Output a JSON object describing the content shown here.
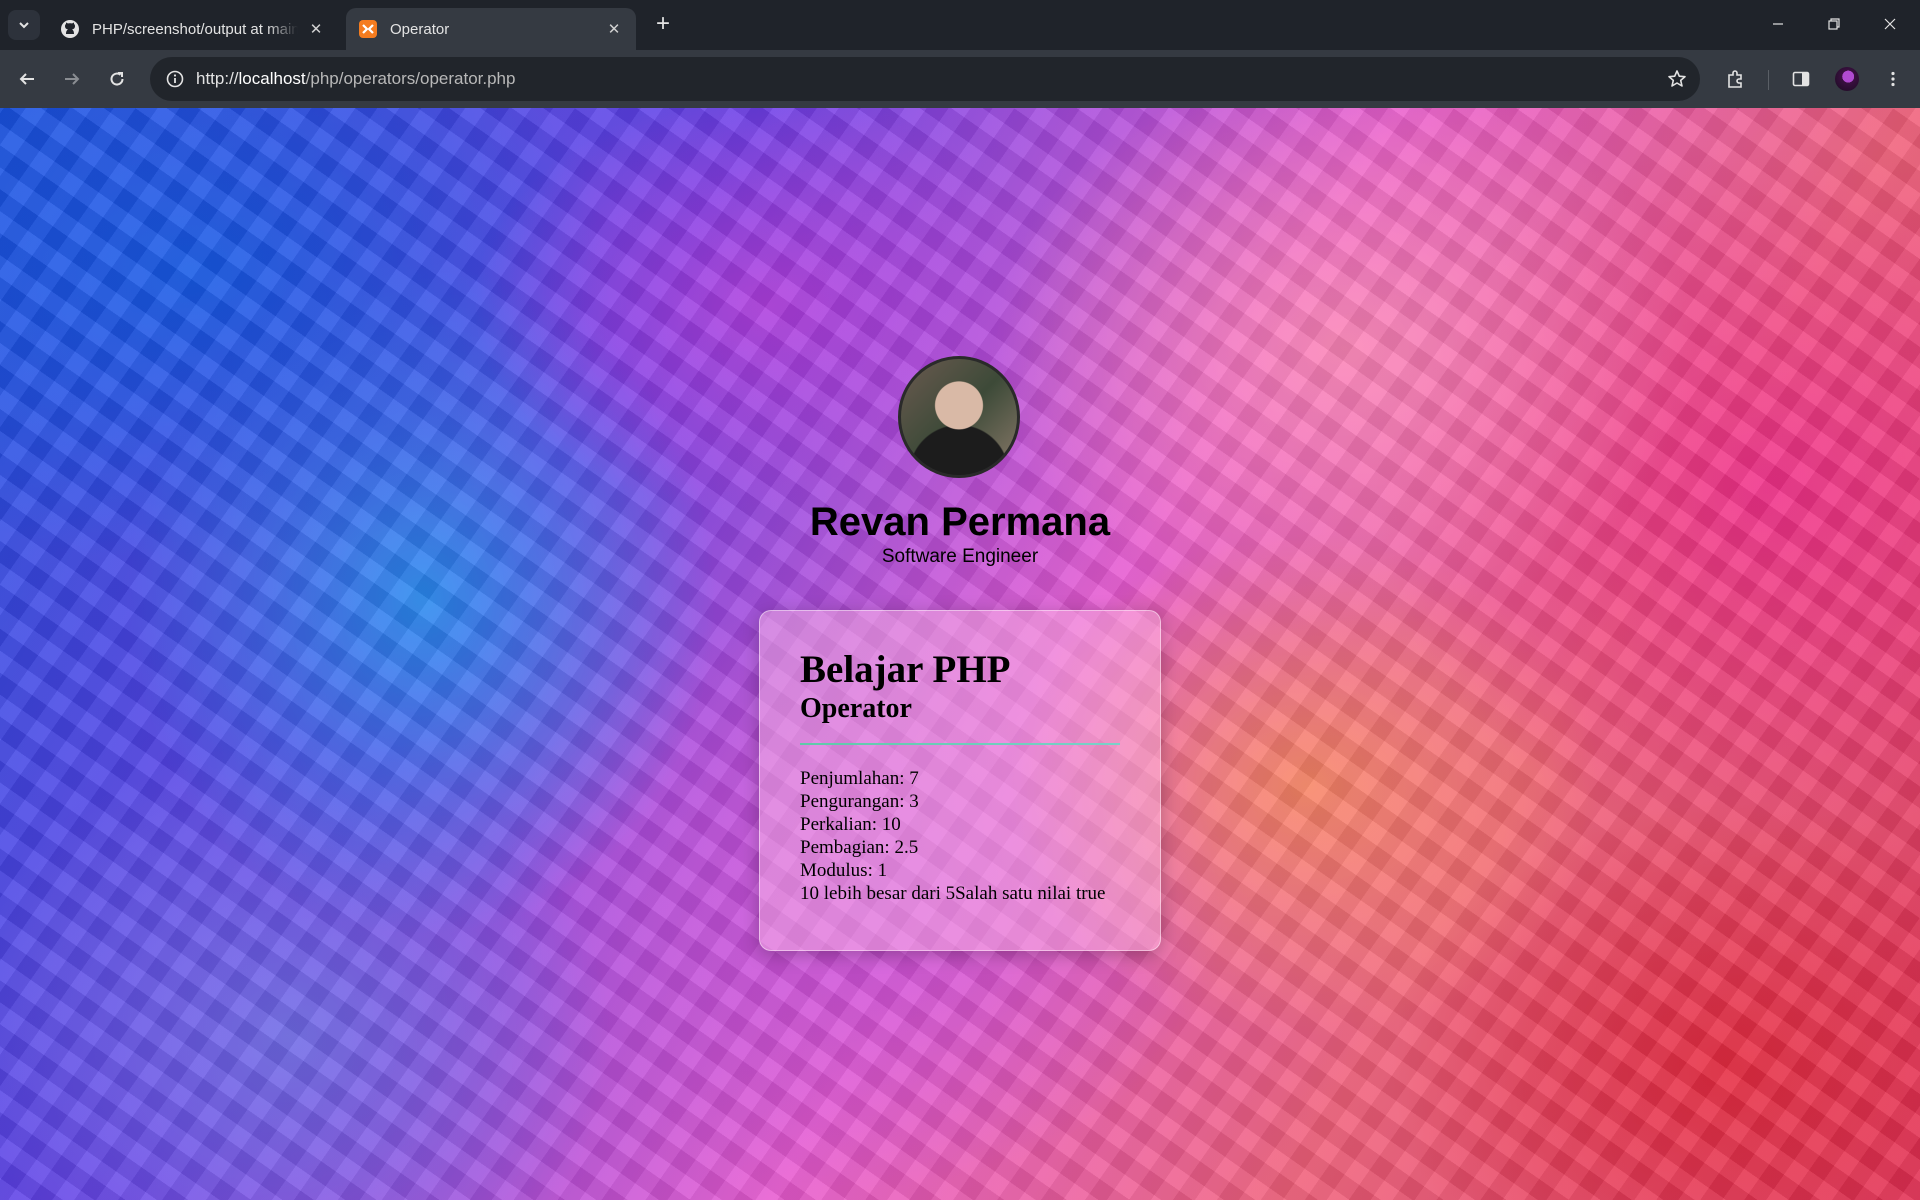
{
  "browser": {
    "tabs": [
      {
        "title": "PHP/screenshot/output at main",
        "active": false,
        "icon": "github-icon"
      },
      {
        "title": "Operator",
        "active": true,
        "icon": "xampp-icon"
      }
    ],
    "address": {
      "scheme": "http://",
      "host": "localhost",
      "path": "/php/operators/operator.php"
    }
  },
  "profile": {
    "name": "Revan Permana",
    "role": "Software Engineer"
  },
  "card": {
    "title": "Belajar PHP",
    "subtitle": "Operator",
    "lines": [
      "Penjumlahan: 7",
      "Pengurangan: 3",
      "Perkalian: 10",
      "Pembagian: 2.5",
      "Modulus: 1",
      "10 lebih besar dari 5Salah satu nilai true"
    ]
  }
}
